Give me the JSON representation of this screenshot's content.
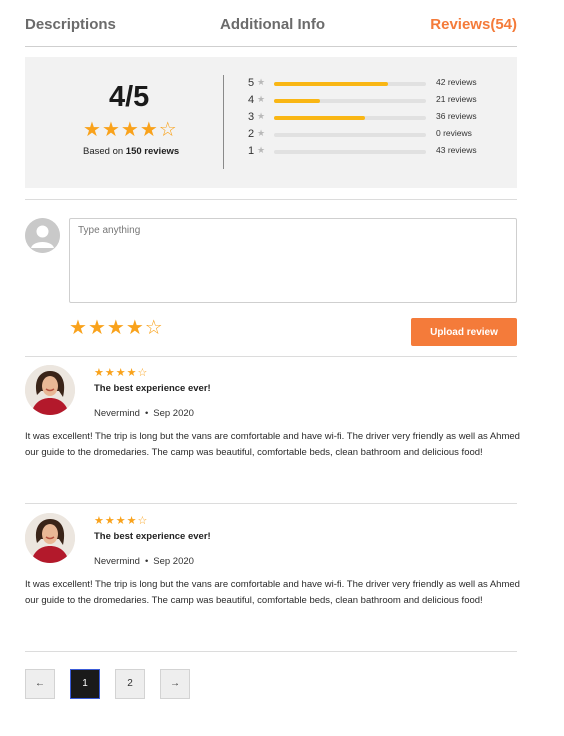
{
  "tabs": [
    {
      "label": "Descriptions"
    },
    {
      "label": "Additional Info"
    },
    {
      "label": "Reviews(54)"
    }
  ],
  "colors": {
    "accent": "#f47b3a",
    "star": "#f9a21b",
    "bar": "#f9b614"
  },
  "summary": {
    "score": "4/5",
    "stars_filled": 4,
    "stars_total": 5,
    "based_prefix": "Based on",
    "based_count": "150 reviews",
    "breakdown": [
      {
        "stars": "5",
        "label": "42 reviews",
        "fill_fraction": 0.75
      },
      {
        "stars": "4",
        "label": "21 reviews",
        "fill_fraction": 0.3
      },
      {
        "stars": "3",
        "label": "36 reviews",
        "fill_fraction": 0.6
      },
      {
        "stars": "2",
        "label": "0 reviews",
        "fill_fraction": 0.0
      },
      {
        "stars": "1",
        "label": "43 reviews",
        "fill_fraction": 0.0
      }
    ]
  },
  "compose": {
    "placeholder": "Type anything",
    "rating_filled": 4,
    "rating_total": 5,
    "upload_label": "Upload review"
  },
  "reviews": [
    {
      "stars_filled": 4,
      "stars_total": 5,
      "title": "The best experience ever!",
      "author": "Nevermind",
      "date": "Sep 2020",
      "body": "It was excellent! The trip is long but the vans are comfortable and have wi-fi. The driver very friendly as well as Ahmed our guide to the dromedaries. The camp was beautiful, comfortable beds, clean bathroom and delicious food!"
    },
    {
      "stars_filled": 4,
      "stars_total": 5,
      "title": "The best experience ever!",
      "author": "Nevermind",
      "date": "Sep 2020",
      "body": "It was excellent! The trip is long but the vans are comfortable and have wi-fi. The driver very friendly as well as Ahmed our guide to the dromedaries. The camp was beautiful, comfortable beds, clean bathroom and delicious food!"
    }
  ],
  "pagination": {
    "prev": "←",
    "pages": [
      "1",
      "2"
    ],
    "current": "1",
    "next": "→"
  }
}
